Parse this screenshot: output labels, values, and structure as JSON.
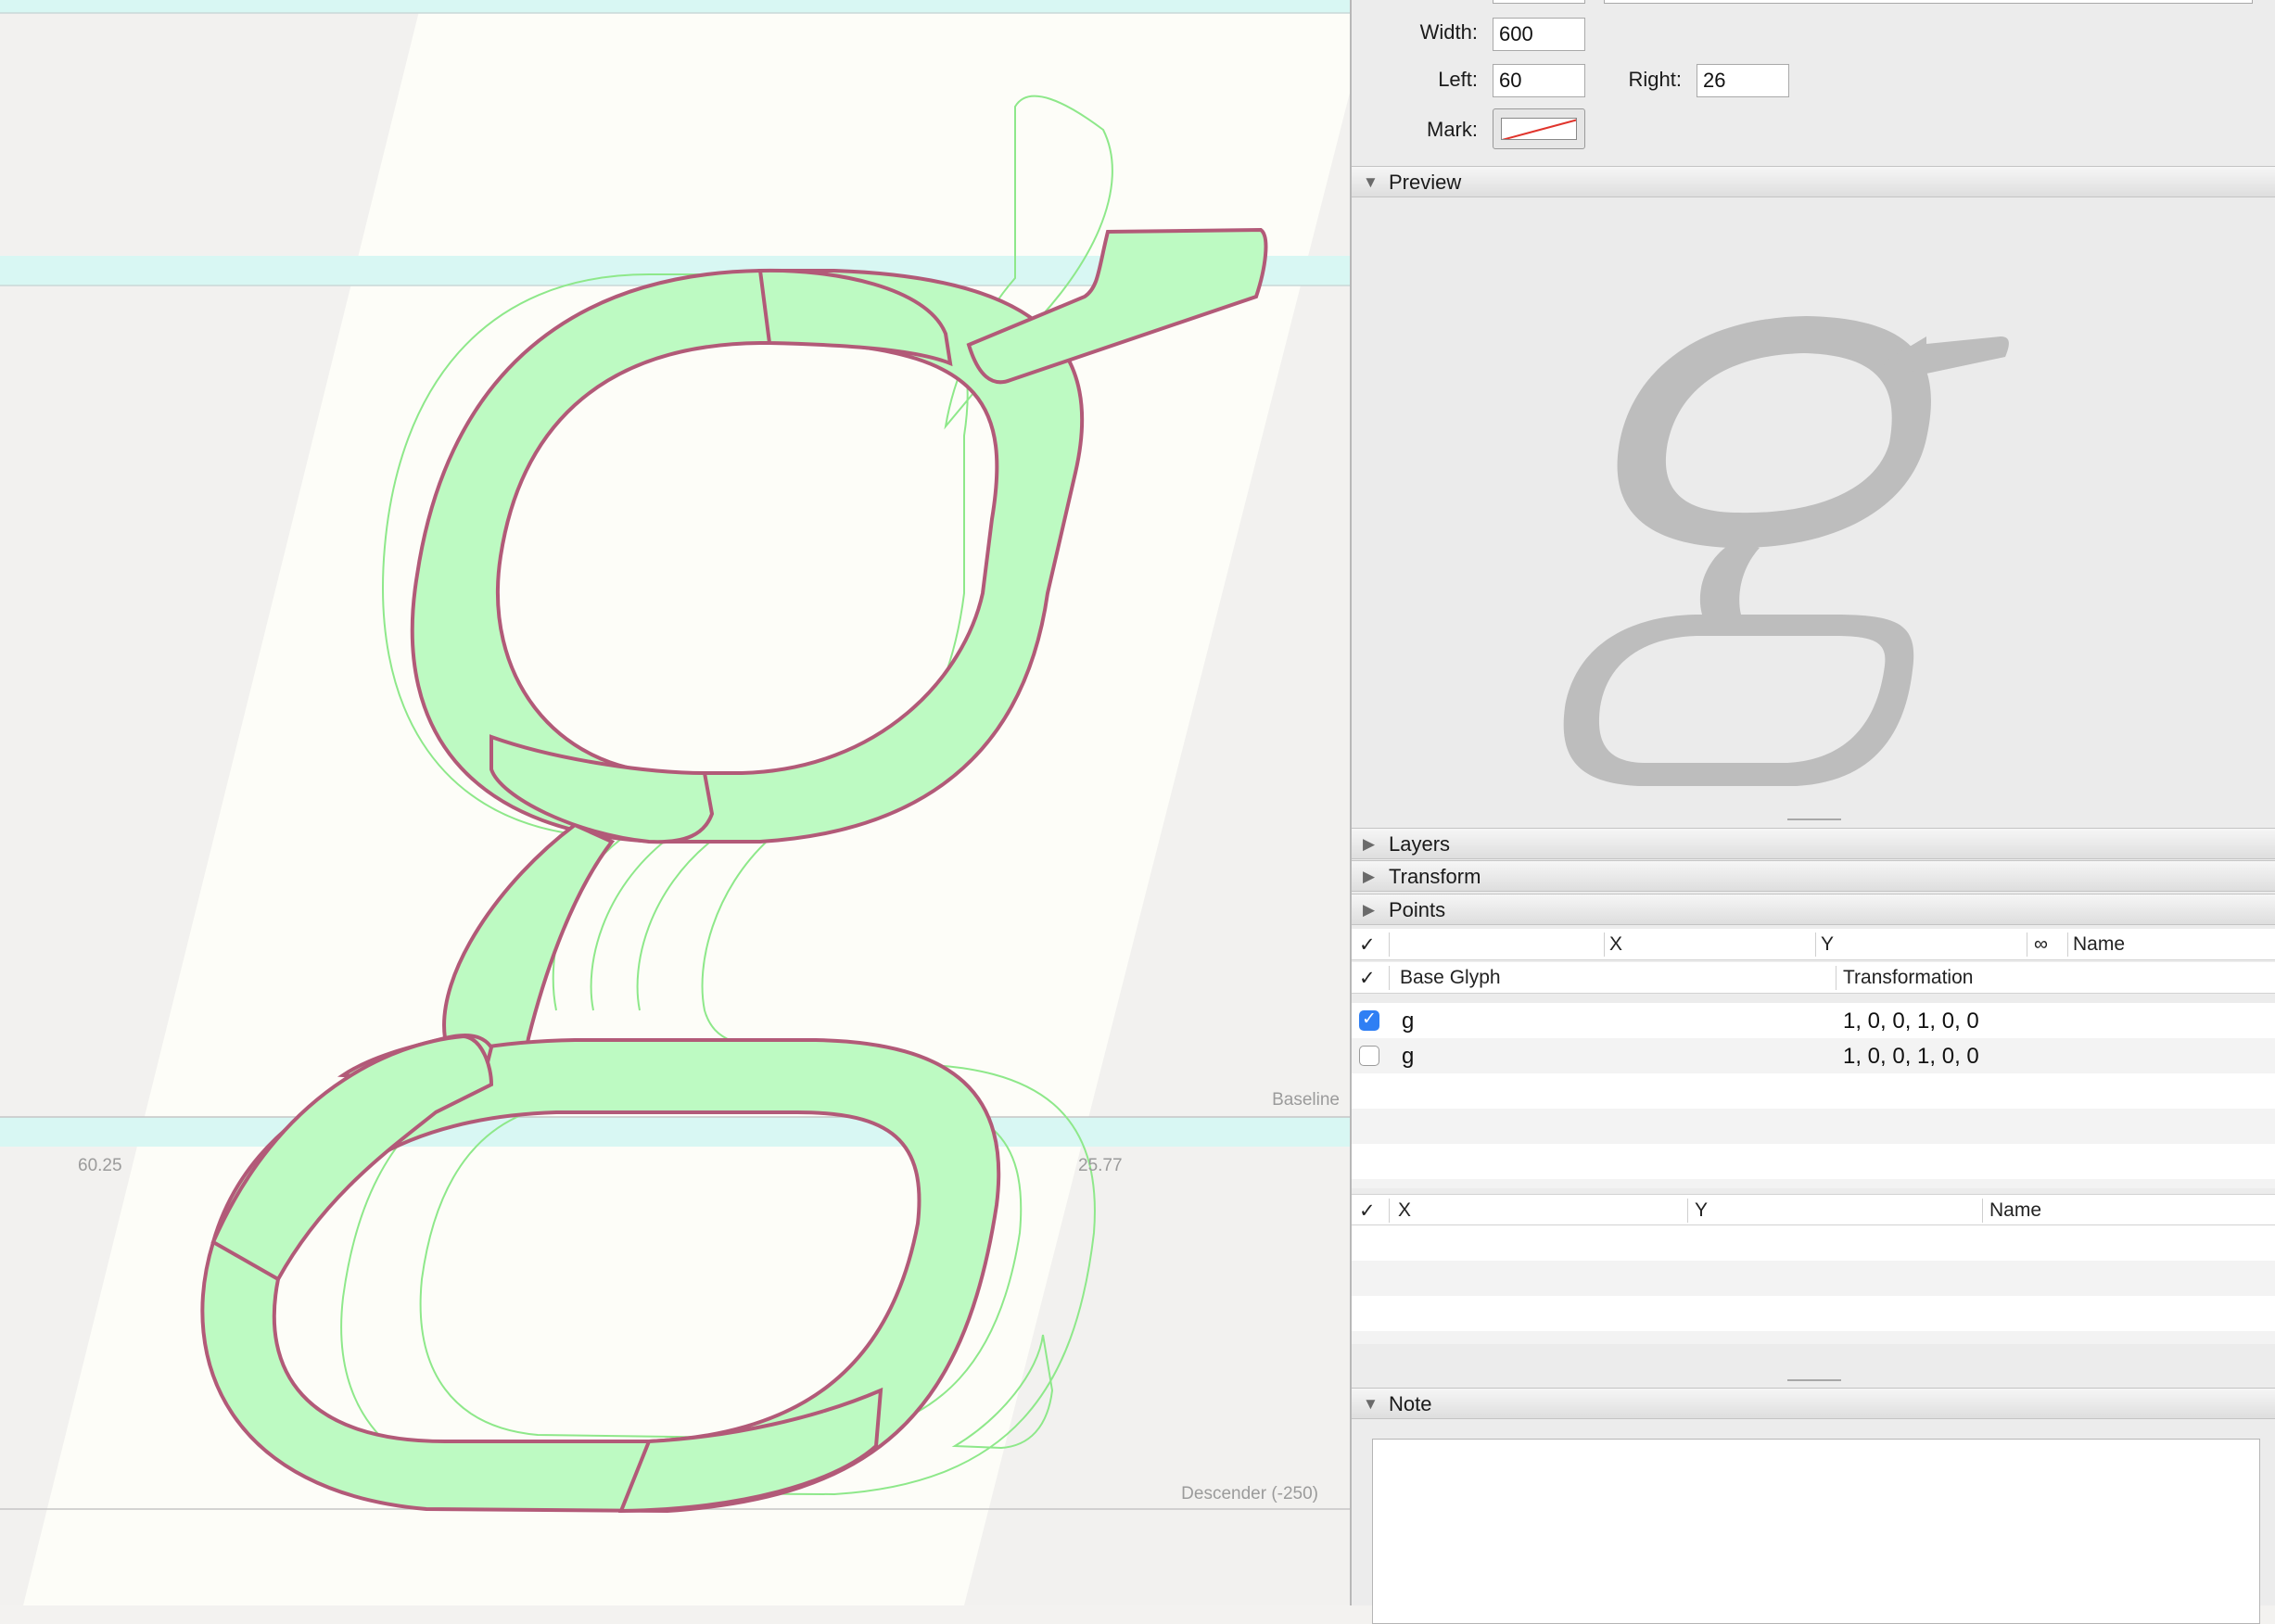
{
  "canvas": {
    "labels": {
      "baseline": "Baseline",
      "descender": "Descender (-250)",
      "left_sidebearing": "60.25",
      "right_sidebearing": "25.77"
    },
    "colors": {
      "background": "#fdfdf8",
      "margin_shade": "#f2f1ef",
      "zone_fill": "#d8f7f3",
      "glyph_fill": "#bdfac2",
      "glyph_stroke": "#b25a78",
      "background_layer_stroke": "#8ee88a"
    }
  },
  "inspector": {
    "width_label": "Width:",
    "width_value": "600",
    "left_label": "Left:",
    "left_value": "60",
    "right_label": "Right:",
    "right_value": "26",
    "mark_label": "Mark:"
  },
  "sections": {
    "preview": "Preview",
    "layers": "Layers",
    "transform": "Transform",
    "points": "Points",
    "note": "Note"
  },
  "points_table": {
    "check_symbol": "✓",
    "columns": [
      "X",
      "Y",
      "∞",
      "Name"
    ]
  },
  "components_table": {
    "check_symbol": "✓",
    "columns": [
      "Base Glyph",
      "Transformation"
    ],
    "rows": [
      {
        "checked": true,
        "base_glyph": "g",
        "transformation": "1, 0, 0, 1, 0, 0"
      },
      {
        "checked": false,
        "base_glyph": "g",
        "transformation": "1, 0, 0, 1, 0, 0"
      }
    ]
  },
  "anchors_table": {
    "check_symbol": "✓",
    "columns": [
      "X",
      "Y",
      "Name"
    ]
  },
  "preview": {
    "glyph_color": "#bdbdbd"
  }
}
